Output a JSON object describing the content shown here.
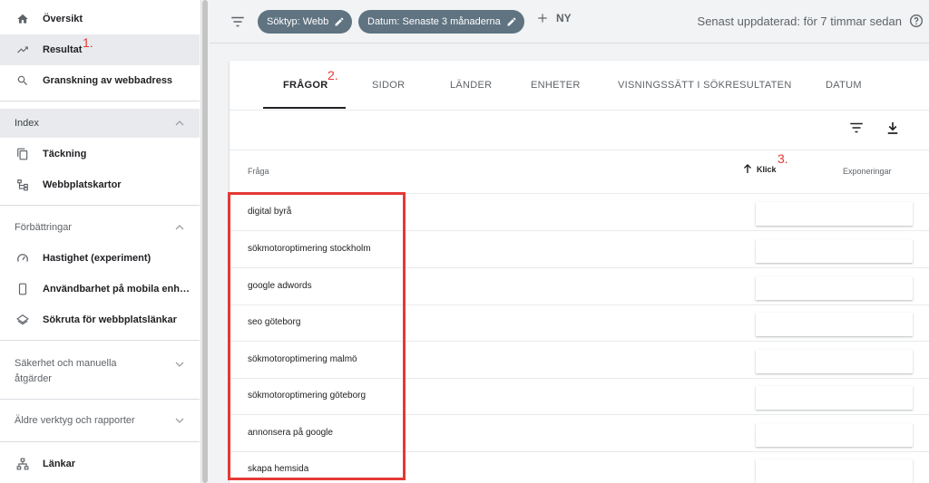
{
  "sidebar": {
    "items": [
      {
        "label": "Översikt",
        "icon": "home-icon"
      },
      {
        "label": "Resultat",
        "icon": "trending-up-icon"
      },
      {
        "label": "Granskning av webbadress",
        "icon": "search-icon"
      }
    ],
    "index_section": {
      "title": "Index",
      "items": [
        {
          "label": "Täckning",
          "icon": "copy-icon"
        },
        {
          "label": "Webbplatskartor",
          "icon": "sitemap-icon"
        }
      ]
    },
    "improvements_section": {
      "title": "Förbättringar",
      "items": [
        {
          "label": "Hastighet (experiment)",
          "icon": "speed-icon"
        },
        {
          "label": "Användbarhet på mobila enh…",
          "icon": "phone-icon"
        },
        {
          "label": "Sökruta för webbplatslänkar",
          "icon": "layers-icon"
        }
      ]
    },
    "security_section": {
      "title_line1": "Säkerhet och manuella",
      "title_line2": "åtgärder"
    },
    "legacy_section": {
      "title": "Äldre verktyg och rapporter"
    },
    "links_item": {
      "label": "Länkar",
      "icon": "links-icon"
    }
  },
  "topbar": {
    "chips": [
      {
        "label": "Söktyp: Webb"
      },
      {
        "label": "Datum: Senaste 3 månaderna"
      }
    ],
    "new_label": "NY",
    "updated": "Senast uppdaterad: för 7 timmar sedan"
  },
  "tabs": [
    "FRÅGOR",
    "SIDOR",
    "LÄNDER",
    "ENHETER",
    "VISNINGSSÄTT I SÖKRESULTATEN",
    "DATUM"
  ],
  "table": {
    "headers": {
      "query": "Fråga",
      "clicks": "Klick",
      "impressions": "Exponeringar"
    },
    "rows": [
      "digital byrå",
      "sökmotoroptimering stockholm",
      "google adwords",
      "seo göteborg",
      "sökmotoroptimering malmö",
      "sökmotoroptimering göteborg",
      "annonsera på google",
      "skapa hemsida"
    ]
  },
  "annotations": {
    "m1": "1.",
    "m2": "2.",
    "m3": "3."
  },
  "colors": {
    "chip": "#5f7381",
    "annotation_red": "#e53935",
    "active_nav": "#e8eaed"
  }
}
